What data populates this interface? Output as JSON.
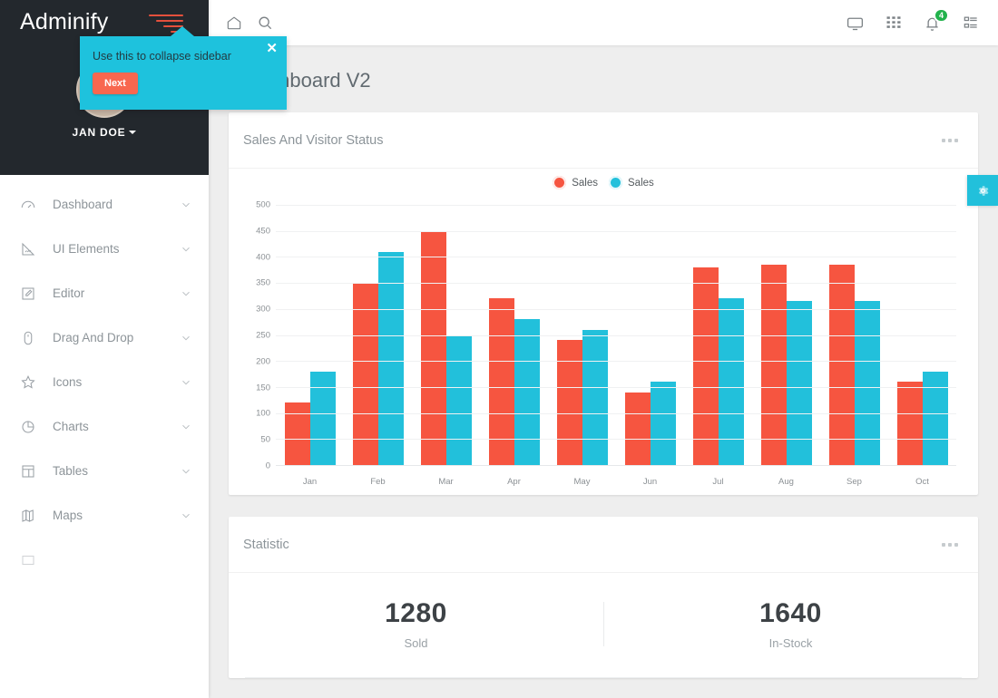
{
  "brand": {
    "name": "Adminify"
  },
  "sidebar": {
    "user": {
      "name": "JAN DOE",
      "avatar": "user-avatar"
    },
    "collapse_icon": "hamburger-icon",
    "items": [
      {
        "label": "Dashboard",
        "icon": "speedometer-icon",
        "chevron": "chevron-down-icon"
      },
      {
        "label": "UI Elements",
        "icon": "ruler-icon",
        "chevron": "chevron-down-icon"
      },
      {
        "label": "Editor",
        "icon": "edit-square-icon",
        "chevron": "chevron-down-icon"
      },
      {
        "label": "Drag And Drop",
        "icon": "mouse-icon",
        "chevron": "chevron-down-icon"
      },
      {
        "label": "Icons",
        "icon": "star-icon",
        "chevron": "chevron-down-icon"
      },
      {
        "label": "Charts",
        "icon": "pie-chart-icon",
        "chevron": "chevron-down-icon"
      },
      {
        "label": "Tables",
        "icon": "table-icon",
        "chevron": "chevron-down-icon"
      },
      {
        "label": "Maps",
        "icon": "map-icon",
        "chevron": "chevron-down-icon"
      },
      {
        "label": "",
        "icon": "forms-icon",
        "chevron": ""
      }
    ]
  },
  "topbar": {
    "left_icons": [
      {
        "name": "home-icon"
      },
      {
        "name": "search-icon"
      }
    ],
    "right_icons": [
      {
        "name": "monitor-icon"
      },
      {
        "name": "grid-icon"
      },
      {
        "name": "bell-icon",
        "badge": "4"
      },
      {
        "name": "list-icon"
      }
    ]
  },
  "page": {
    "title": "Dashboard V2"
  },
  "tour": {
    "text": "Use this to collapse sidebar",
    "next_label": "Next",
    "close_icon": "close-icon",
    "bg_color": "#1ec2dd",
    "button_color": "#f8674f"
  },
  "settings_tab": {
    "icon": "gear-icon",
    "color": "#22c0db"
  },
  "cards": {
    "sales": {
      "title": "Sales And Visitor Status",
      "menu_icon": "more-options-icon"
    },
    "statistic": {
      "title": "Statistic",
      "menu_icon": "more-options-icon",
      "metrics": [
        {
          "value": "1280",
          "label": "Sold"
        },
        {
          "value": "1640",
          "label": "In-Stock"
        }
      ]
    }
  },
  "chart_data": {
    "type": "bar",
    "title": "Sales And Visitor Status",
    "xlabel": "",
    "ylabel": "",
    "ylim": [
      0,
      500
    ],
    "yticks": [
      0,
      50,
      100,
      150,
      200,
      250,
      300,
      350,
      400,
      450,
      500
    ],
    "grid": true,
    "legend_position": "top-center",
    "categories": [
      "Jan",
      "Feb",
      "Mar",
      "Apr",
      "May",
      "Jun",
      "Jul",
      "Aug",
      "Sep",
      "Oct"
    ],
    "series": [
      {
        "name": "Sales",
        "color": "#f65540",
        "values": [
          120,
          350,
          450,
          320,
          240,
          140,
          380,
          385,
          385,
          160
        ]
      },
      {
        "name": "Sales",
        "color": "#22c0db",
        "values": [
          180,
          410,
          250,
          280,
          260,
          160,
          320,
          315,
          315,
          180
        ]
      }
    ]
  }
}
